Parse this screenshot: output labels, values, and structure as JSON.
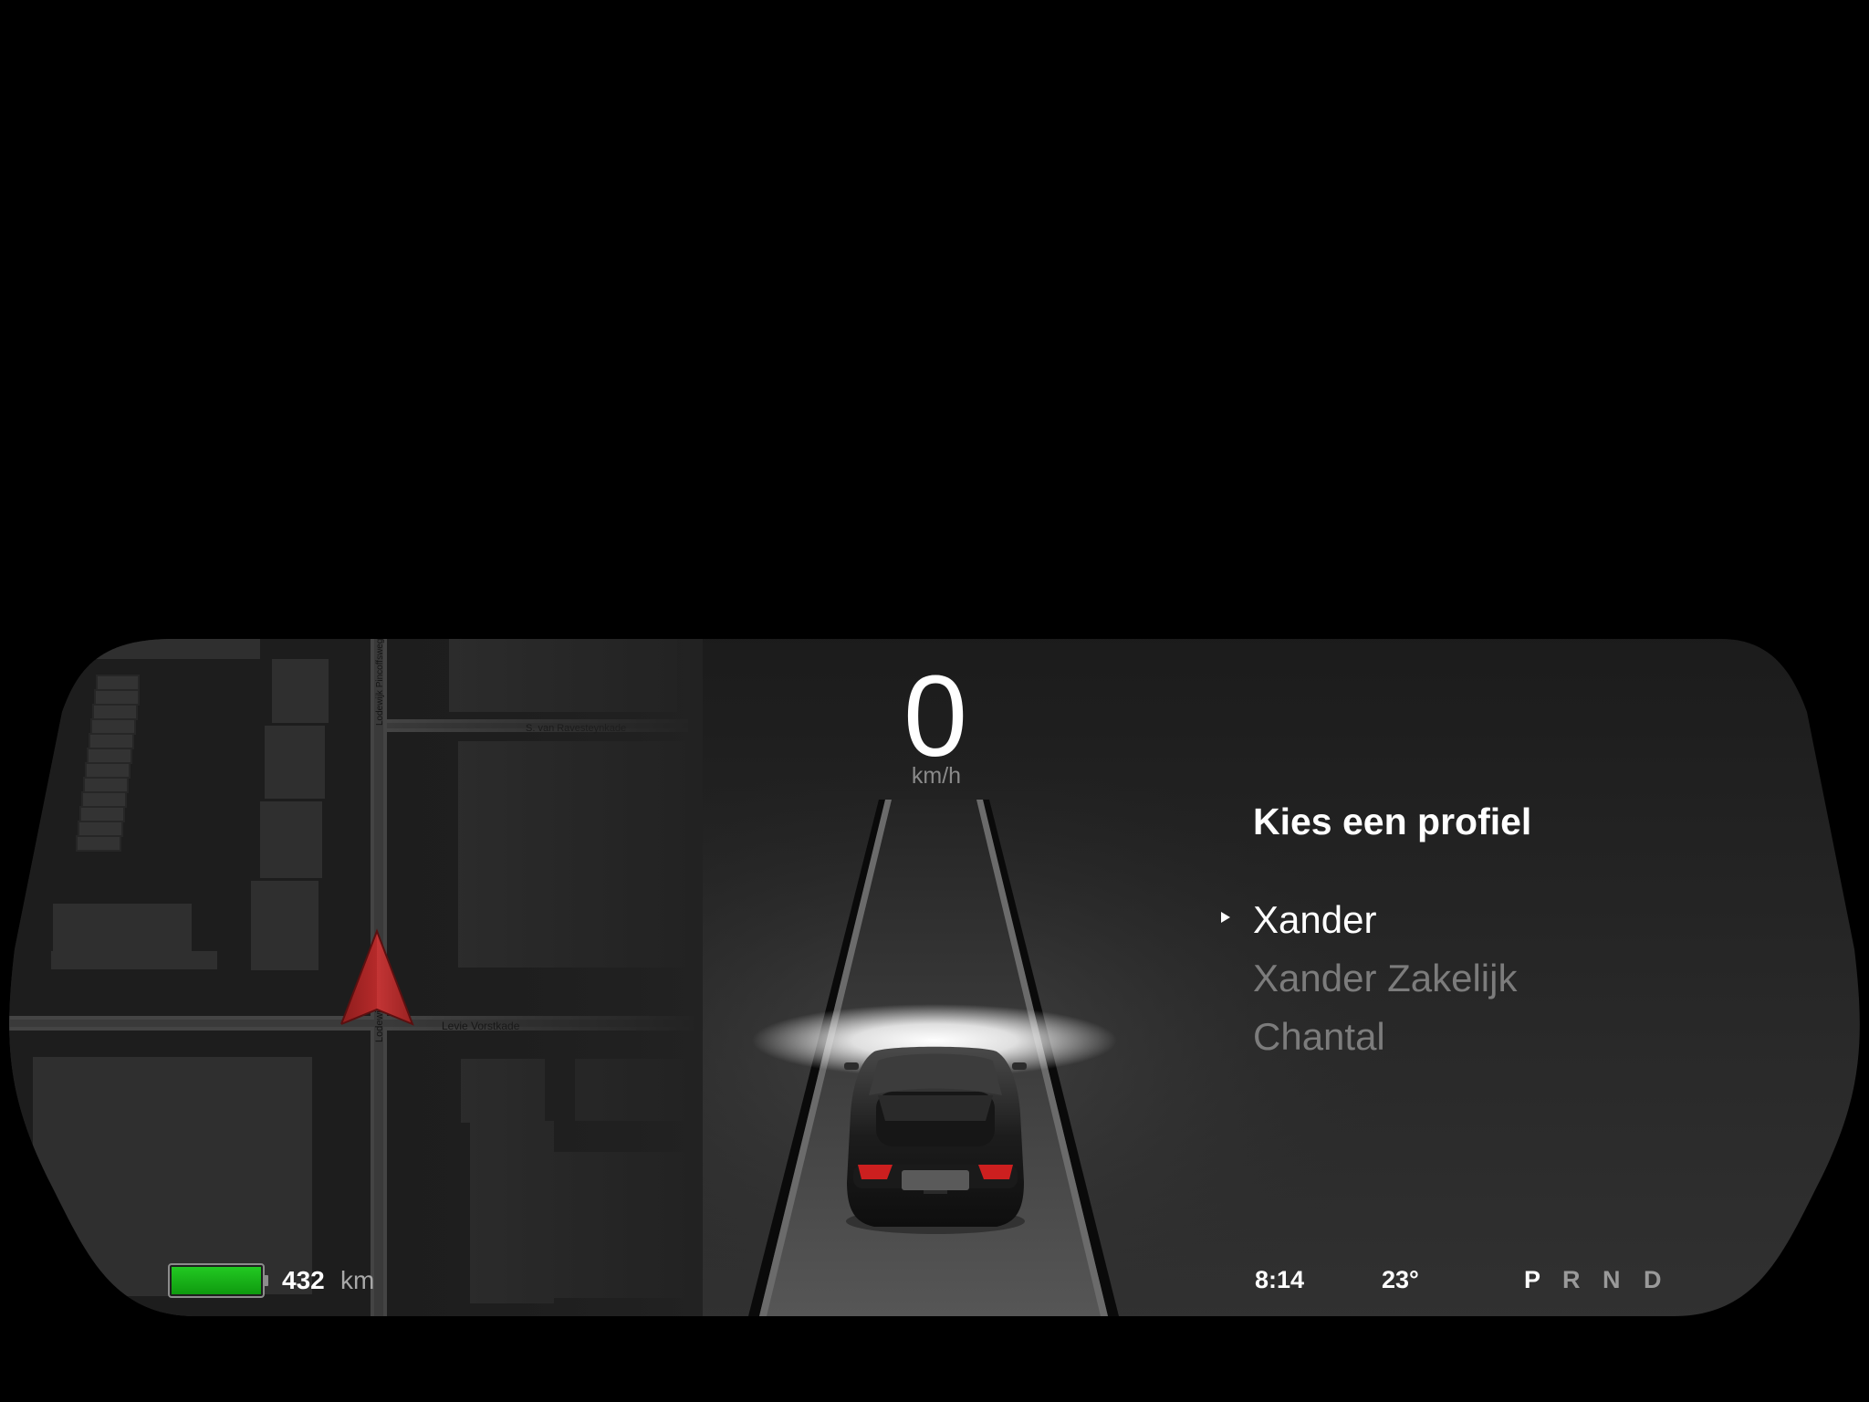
{
  "speed": {
    "value": "0",
    "unit": "km/h"
  },
  "profile_menu": {
    "title": "Kies een profiel",
    "items": [
      {
        "label": "Xander",
        "selected": true
      },
      {
        "label": "Xander Zakelijk",
        "selected": false
      },
      {
        "label": "Chantal",
        "selected": false
      }
    ]
  },
  "battery": {
    "range_value": "432",
    "range_unit": "km",
    "charge_fraction": 1.0,
    "fill_color": "#16b516"
  },
  "status": {
    "time": "8:14",
    "temperature": "23°"
  },
  "gears": [
    {
      "label": "P",
      "active": true
    },
    {
      "label": "R",
      "active": false
    },
    {
      "label": "N",
      "active": false
    },
    {
      "label": "D",
      "active": false
    }
  ],
  "map": {
    "street_labels": [
      "S. van Ravesteynkade",
      "Levie Vorstkade",
      "Lodewijk Pincoffsweg",
      "Lodewijk"
    ],
    "heading_icon": "navigation-arrow-icon",
    "arrow_color": "#b52a2a"
  },
  "colors": {
    "background": "#000000",
    "panel": "#262626",
    "text_primary": "#ffffff",
    "text_muted": "#7c7c7c",
    "taillight": "#cc1f1f"
  }
}
